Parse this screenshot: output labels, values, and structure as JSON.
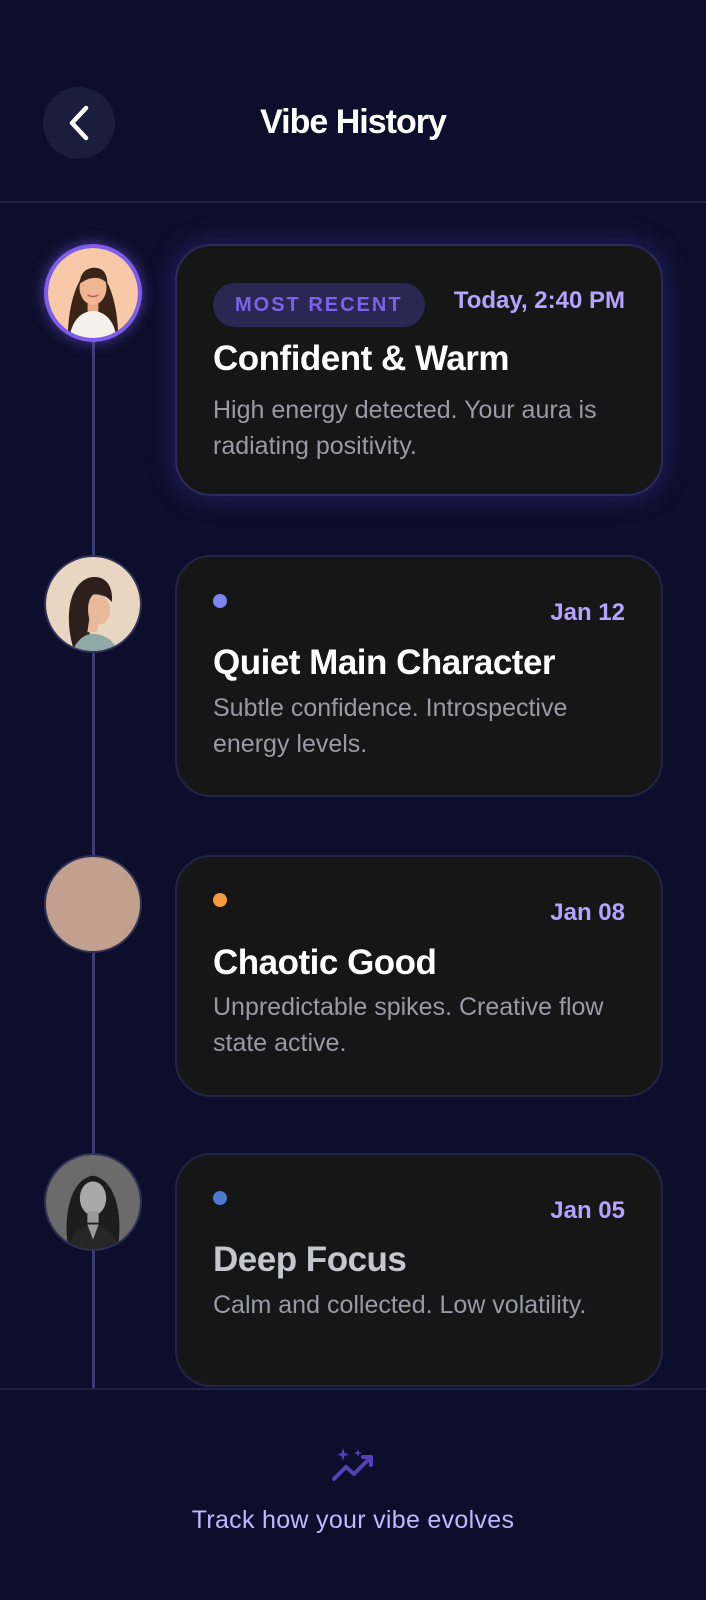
{
  "header": {
    "title": "Vibe History"
  },
  "entries": [
    {
      "badge": "MOST RECENT",
      "date": "Today, 2:40 PM",
      "title": "Confident & Warm",
      "description": "High energy detected. Your aura is radiating positivity."
    },
    {
      "date": "Jan 12",
      "title": "Quiet Main Character",
      "description": "Subtle confidence. Introspective energy levels.",
      "dot_color": "#7b86ee"
    },
    {
      "date": "Jan 08",
      "title": "Chaotic Good",
      "description": "Unpredictable spikes. Creative flow state active.",
      "dot_color": "#f39a3c"
    },
    {
      "date": "Jan 05",
      "title": "Deep Focus",
      "description": "Calm and collected. Low volatility.",
      "dot_color": "#4d7ad0"
    }
  ],
  "footer": {
    "text": "Track how your vibe evolves"
  },
  "colors": {
    "background": "#0d0e2b",
    "card": "#161616",
    "accent": "#7d5cf0",
    "date": "#b4a4ff"
  }
}
